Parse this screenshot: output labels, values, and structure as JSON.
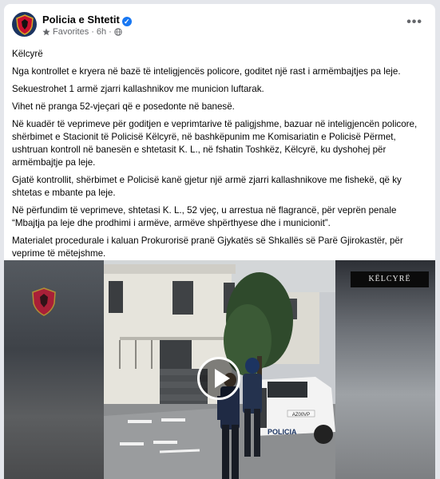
{
  "post": {
    "page_name": "Policia e Shtetit",
    "meta": {
      "favorites_label": "Favorites",
      "separator": "·",
      "time": "6h",
      "separator2": "·"
    },
    "paragraphs": [
      "Këlcyrë",
      "Nga kontrollet e kryera në bazë të inteligjencës policore, goditet një rast i armëmbajtjes pa leje.",
      "Sekuestrohet 1 armë zjarri kallashnikov me municion luftarak.",
      "Vihet në pranga 52-vjeçari që e posedonte në banesë.",
      "Në kuadër të veprimeve për goditjen e veprimtarive të paligjshme, bazuar në inteligjencën policore, shërbimet e Stacionit të Policisë Këlcyrë, në bashkëpunim me Komisariatin e Policisë Përmet, ushtruan kontroll në banesën e shtetasit K. L., në fshatin Toshkëz, Këlcyrë, ku dyshohej për armëmbajtje pa leje.",
      "Gjatë kontrollit, shërbimet e Policisë kanë gjetur një armë zjarri kallashnikove me fishekë, që ky shtetas e mbante pa leje.",
      "Në përfundim të veprimeve, shtetasi K. L., 52 vjeç, u arrestua në flagrancë, për veprën penale “Mbajtja pa leje dhe prodhimi i armëve, armëve shpërthyese dhe i municionit”.",
      "Materialet procedurale i kaluan Prokurorisë pranë Gjykatës së Shkallës së Parë Gjirokastër, për veprime të mëtejshme."
    ],
    "video": {
      "location_label": "KËLCYRË",
      "car_label": "POLICIA",
      "plate": "AZ00VP"
    }
  },
  "icons": {
    "verified": "verified-badge-icon",
    "favorites": "star-icon",
    "audience": "globe-icon",
    "more": "more-options-icon",
    "play": "play-icon"
  },
  "colors": {
    "brand_blue": "#1877f2",
    "police_navy": "#1c3461",
    "text_primary": "#050505",
    "text_secondary": "#65676b"
  }
}
